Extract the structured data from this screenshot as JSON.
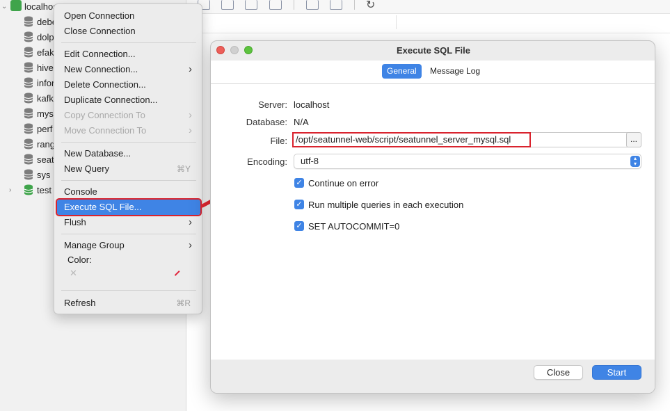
{
  "sidebar": {
    "root": {
      "label": "localhost"
    },
    "items": [
      {
        "label": "debe"
      },
      {
        "label": "dolp"
      },
      {
        "label": "efak"
      },
      {
        "label": "hive"
      },
      {
        "label": "infor"
      },
      {
        "label": "kafk"
      },
      {
        "label": "mys"
      },
      {
        "label": "perf"
      },
      {
        "label": "rang"
      },
      {
        "label": "seat"
      },
      {
        "label": "sys"
      },
      {
        "label": "test"
      }
    ]
  },
  "context_menu": {
    "open_connection": "Open Connection",
    "close_connection": "Close Connection",
    "edit_connection": "Edit Connection...",
    "new_connection": "New Connection...",
    "delete_connection": "Delete Connection...",
    "duplicate_connection": "Duplicate Connection...",
    "copy_connection_to": "Copy Connection To",
    "move_connection_to": "Move Connection To",
    "new_database": "New Database...",
    "new_query": "New Query",
    "new_query_shortcut": "⌘Y",
    "console": "Console",
    "execute_sql_file": "Execute SQL File...",
    "flush": "Flush",
    "manage_group": "Manage Group",
    "color_label": "Color:",
    "color_clear": "✕",
    "refresh": "Refresh",
    "refresh_shortcut": "⌘R"
  },
  "dialog": {
    "title": "Execute SQL File",
    "tabs": {
      "general": "General",
      "message_log": "Message Log"
    },
    "server_label": "Server:",
    "server_value": "localhost",
    "database_label": "Database:",
    "database_value": "N/A",
    "file_label": "File:",
    "file_value": "/opt/seatunnel-web/script/seatunnel_server_mysql.sql",
    "browse_label": "...",
    "encoding_label": "Encoding:",
    "encoding_value": "utf-8",
    "options": [
      {
        "label": "Continue on error",
        "checked": true
      },
      {
        "label": "Run multiple queries in each execution",
        "checked": true
      },
      {
        "label": "SET AUTOCOMMIT=0",
        "checked": true
      }
    ],
    "close_button": "Close",
    "start_button": "Start"
  },
  "colors": {
    "accent": "#3f84e5",
    "highlight_red": "#d9232e",
    "connection_green": "#3fa44b"
  },
  "icons": {
    "database": "database-icon",
    "connection": "mysql-connection-icon",
    "refresh": "refresh-icon",
    "checkbox": "checkmark-icon",
    "submenu": "chevron-right-icon"
  }
}
